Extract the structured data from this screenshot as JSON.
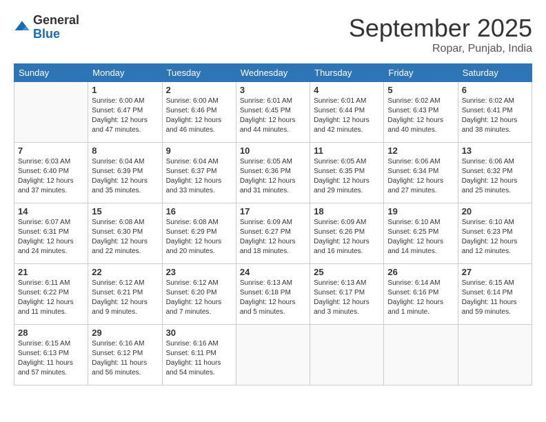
{
  "logo": {
    "general": "General",
    "blue": "Blue"
  },
  "header": {
    "month": "September 2025",
    "location": "Ropar, Punjab, India"
  },
  "weekdays": [
    "Sunday",
    "Monday",
    "Tuesday",
    "Wednesday",
    "Thursday",
    "Friday",
    "Saturday"
  ],
  "weeks": [
    [
      {
        "day": "",
        "info": ""
      },
      {
        "day": "1",
        "info": "Sunrise: 6:00 AM\nSunset: 6:47 PM\nDaylight: 12 hours\nand 47 minutes."
      },
      {
        "day": "2",
        "info": "Sunrise: 6:00 AM\nSunset: 6:46 PM\nDaylight: 12 hours\nand 46 minutes."
      },
      {
        "day": "3",
        "info": "Sunrise: 6:01 AM\nSunset: 6:45 PM\nDaylight: 12 hours\nand 44 minutes."
      },
      {
        "day": "4",
        "info": "Sunrise: 6:01 AM\nSunset: 6:44 PM\nDaylight: 12 hours\nand 42 minutes."
      },
      {
        "day": "5",
        "info": "Sunrise: 6:02 AM\nSunset: 6:43 PM\nDaylight: 12 hours\nand 40 minutes."
      },
      {
        "day": "6",
        "info": "Sunrise: 6:02 AM\nSunset: 6:41 PM\nDaylight: 12 hours\nand 38 minutes."
      }
    ],
    [
      {
        "day": "7",
        "info": "Sunrise: 6:03 AM\nSunset: 6:40 PM\nDaylight: 12 hours\nand 37 minutes."
      },
      {
        "day": "8",
        "info": "Sunrise: 6:04 AM\nSunset: 6:39 PM\nDaylight: 12 hours\nand 35 minutes."
      },
      {
        "day": "9",
        "info": "Sunrise: 6:04 AM\nSunset: 6:37 PM\nDaylight: 12 hours\nand 33 minutes."
      },
      {
        "day": "10",
        "info": "Sunrise: 6:05 AM\nSunset: 6:36 PM\nDaylight: 12 hours\nand 31 minutes."
      },
      {
        "day": "11",
        "info": "Sunrise: 6:05 AM\nSunset: 6:35 PM\nDaylight: 12 hours\nand 29 minutes."
      },
      {
        "day": "12",
        "info": "Sunrise: 6:06 AM\nSunset: 6:34 PM\nDaylight: 12 hours\nand 27 minutes."
      },
      {
        "day": "13",
        "info": "Sunrise: 6:06 AM\nSunset: 6:32 PM\nDaylight: 12 hours\nand 25 minutes."
      }
    ],
    [
      {
        "day": "14",
        "info": "Sunrise: 6:07 AM\nSunset: 6:31 PM\nDaylight: 12 hours\nand 24 minutes."
      },
      {
        "day": "15",
        "info": "Sunrise: 6:08 AM\nSunset: 6:30 PM\nDaylight: 12 hours\nand 22 minutes."
      },
      {
        "day": "16",
        "info": "Sunrise: 6:08 AM\nSunset: 6:29 PM\nDaylight: 12 hours\nand 20 minutes."
      },
      {
        "day": "17",
        "info": "Sunrise: 6:09 AM\nSunset: 6:27 PM\nDaylight: 12 hours\nand 18 minutes."
      },
      {
        "day": "18",
        "info": "Sunrise: 6:09 AM\nSunset: 6:26 PM\nDaylight: 12 hours\nand 16 minutes."
      },
      {
        "day": "19",
        "info": "Sunrise: 6:10 AM\nSunset: 6:25 PM\nDaylight: 12 hours\nand 14 minutes."
      },
      {
        "day": "20",
        "info": "Sunrise: 6:10 AM\nSunset: 6:23 PM\nDaylight: 12 hours\nand 12 minutes."
      }
    ],
    [
      {
        "day": "21",
        "info": "Sunrise: 6:11 AM\nSunset: 6:22 PM\nDaylight: 12 hours\nand 11 minutes."
      },
      {
        "day": "22",
        "info": "Sunrise: 6:12 AM\nSunset: 6:21 PM\nDaylight: 12 hours\nand 9 minutes."
      },
      {
        "day": "23",
        "info": "Sunrise: 6:12 AM\nSunset: 6:20 PM\nDaylight: 12 hours\nand 7 minutes."
      },
      {
        "day": "24",
        "info": "Sunrise: 6:13 AM\nSunset: 6:18 PM\nDaylight: 12 hours\nand 5 minutes."
      },
      {
        "day": "25",
        "info": "Sunrise: 6:13 AM\nSunset: 6:17 PM\nDaylight: 12 hours\nand 3 minutes."
      },
      {
        "day": "26",
        "info": "Sunrise: 6:14 AM\nSunset: 6:16 PM\nDaylight: 12 hours\nand 1 minute."
      },
      {
        "day": "27",
        "info": "Sunrise: 6:15 AM\nSunset: 6:14 PM\nDaylight: 11 hours\nand 59 minutes."
      }
    ],
    [
      {
        "day": "28",
        "info": "Sunrise: 6:15 AM\nSunset: 6:13 PM\nDaylight: 11 hours\nand 57 minutes."
      },
      {
        "day": "29",
        "info": "Sunrise: 6:16 AM\nSunset: 6:12 PM\nDaylight: 11 hours\nand 56 minutes."
      },
      {
        "day": "30",
        "info": "Sunrise: 6:16 AM\nSunset: 6:11 PM\nDaylight: 11 hours\nand 54 minutes."
      },
      {
        "day": "",
        "info": ""
      },
      {
        "day": "",
        "info": ""
      },
      {
        "day": "",
        "info": ""
      },
      {
        "day": "",
        "info": ""
      }
    ]
  ]
}
